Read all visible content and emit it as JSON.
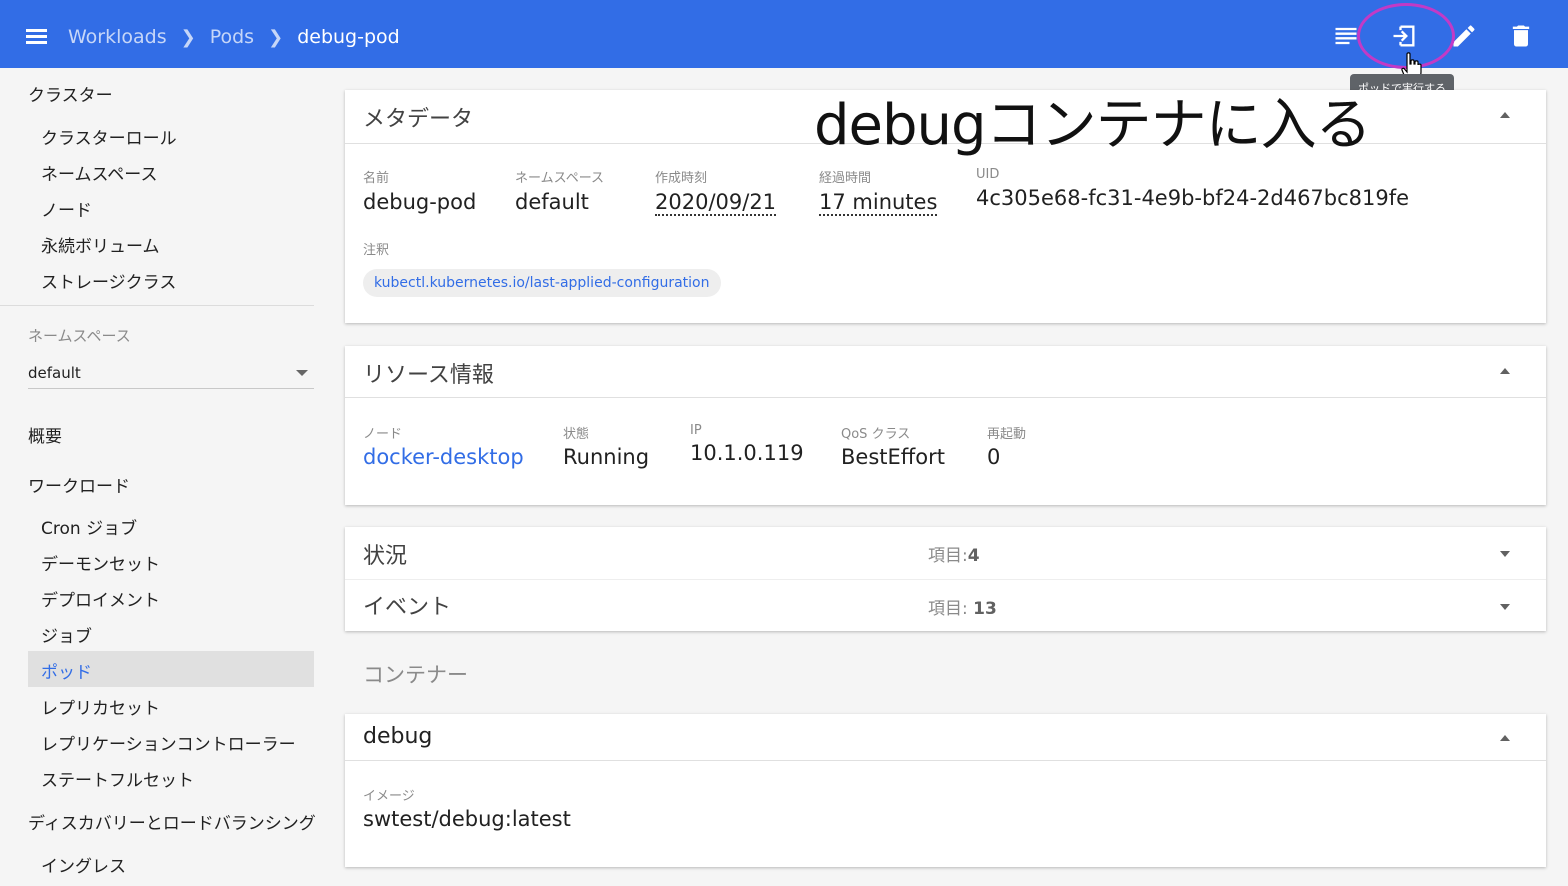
{
  "breadcrumb": {
    "workloads": "Workloads",
    "pods": "Pods",
    "current": "debug-pod"
  },
  "toolbar": {
    "tooltip": "ポッドで実行する"
  },
  "annotation_text": "debugコンテナに入る",
  "sidebar": {
    "cluster": "クラスター",
    "cluster_items": [
      "クラスターロール",
      "ネームスペース",
      "ノード",
      "永続ボリューム",
      "ストレージクラス"
    ],
    "namespace_label": "ネームスペース",
    "namespace_value": "default",
    "overview": "概要",
    "workloads": "ワークロード",
    "workload_items": [
      "Cron ジョブ",
      "デーモンセット",
      "デプロイメント",
      "ジョブ",
      "ポッド",
      "レプリカセット",
      "レプリケーションコントローラー",
      "ステートフルセット"
    ],
    "discovery": "ディスカバリーとロードバランシング",
    "discovery_items": [
      "イングレス"
    ]
  },
  "metadata": {
    "title": "メタデータ",
    "name_label": "名前",
    "name": "debug-pod",
    "ns_label": "ネームスペース",
    "ns": "default",
    "created_label": "作成時刻",
    "created": "2020/09/21",
    "age_label": "経過時間",
    "age": "17 minutes",
    "uid_label": "UID",
    "uid": "4c305e68-fc31-4e9b-bf24-2d467bc819fe",
    "annotations_label": "注釈",
    "annotation": "kubectl.kubernetes.io/last-applied-configuration"
  },
  "resource": {
    "title": "リソース情報",
    "node_label": "ノード",
    "node": "docker-desktop",
    "status_label": "状態",
    "status": "Running",
    "ip_label": "IP",
    "ip": "10.1.0.119",
    "qos_label": "QoS クラス",
    "qos": "BestEffort",
    "restarts_label": "再起動",
    "restarts": "0"
  },
  "conditions": {
    "title": "状況",
    "count_label": "項目:",
    "count": "4"
  },
  "events": {
    "title": "イベント",
    "count_label": "項目: ",
    "count": "13"
  },
  "containers_title": "コンテナー",
  "container": {
    "name": "debug",
    "image_label": "イメージ",
    "image": "swtest/debug:latest"
  },
  "colors": {
    "topbar": "#326de6",
    "link": "#326de6",
    "highlight": "#c23ac6"
  },
  "icons": [
    "menu-icon",
    "logs-icon",
    "exec-icon",
    "edit-icon",
    "delete-icon"
  ]
}
